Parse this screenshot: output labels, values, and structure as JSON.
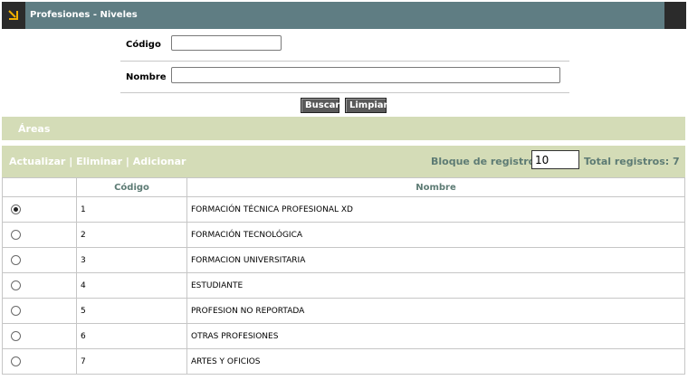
{
  "window": {
    "title": "Profesiones - Niveles",
    "icon": "resize-corner-icon"
  },
  "search": {
    "codigo_label": "Código",
    "codigo_value": "",
    "nombre_label": "Nombre",
    "nombre_value": "",
    "buscar_label": "Buscar",
    "limpiar_label": "Limpiar"
  },
  "section": {
    "title": "Áreas"
  },
  "toolbar": {
    "actualizar_label": "Actualizar",
    "eliminar_label": "Eliminar",
    "adicionar_label": "Adicionar",
    "separator": "|",
    "bloque_label": "Bloque de registros:",
    "bloque_value": "10",
    "total_label": "Total registros: 7"
  },
  "table": {
    "columns": [
      "",
      "Código",
      "Nombre"
    ],
    "rows": [
      {
        "codigo": "1",
        "nombre": "FORMACIÓN TÉCNICA PROFESIONAL XD",
        "selected": true
      },
      {
        "codigo": "2",
        "nombre": "FORMACIÓN TECNOLÓGICA",
        "selected": false
      },
      {
        "codigo": "3",
        "nombre": "FORMACION UNIVERSITARIA",
        "selected": false
      },
      {
        "codigo": "4",
        "nombre": "ESTUDIANTE",
        "selected": false
      },
      {
        "codigo": "5",
        "nombre": "PROFESION NO REPORTADA",
        "selected": false
      },
      {
        "codigo": "6",
        "nombre": "OTRAS PROFESIONES",
        "selected": false
      },
      {
        "codigo": "7",
        "nombre": "ARTES Y OFICIOS",
        "selected": false
      }
    ]
  },
  "colors": {
    "titlebar": "#5f7d83",
    "band": "#d4dcb7",
    "accent_text": "#5d7b74",
    "icon_accent": "#f0b000"
  }
}
